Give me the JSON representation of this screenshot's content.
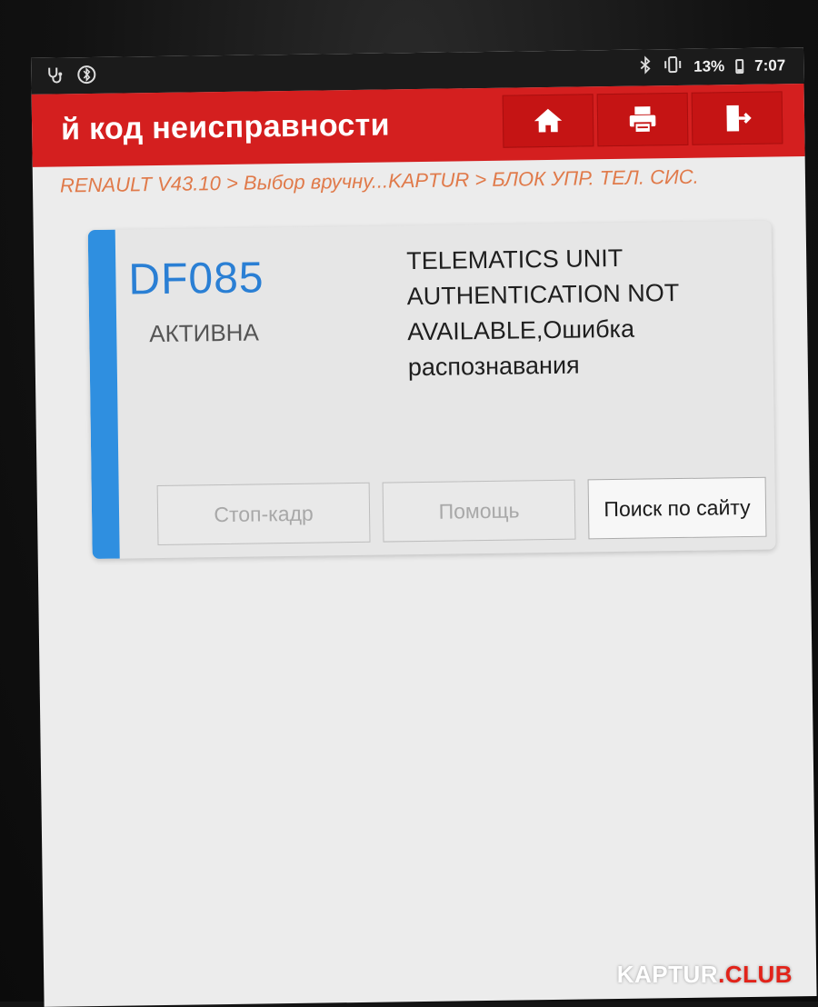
{
  "status_bar": {
    "battery_percent": "13%",
    "time": "7:07",
    "icons": [
      "stethoscope-icon",
      "bluetooth-badge-icon",
      "bluetooth-icon",
      "vibrate-icon",
      "battery-icon"
    ]
  },
  "header": {
    "title": "й код неисправности",
    "buttons": [
      {
        "name": "home",
        "icon": "home-icon"
      },
      {
        "name": "print",
        "icon": "printer-icon"
      },
      {
        "name": "exit",
        "icon": "exit-icon"
      }
    ],
    "color": "#d41f1f"
  },
  "breadcrumb": {
    "text": "RENAULT V43.10 > Выбор вручну...KAPTUR > БЛОК УПР. ТЕЛ. СИС."
  },
  "dtc": {
    "code": "DF085",
    "status": "АКТИВНА",
    "description_lines": [
      "TELEMATICS UNIT",
      "AUTHENTICATION NOT",
      "AVAILABLE,Ошибка",
      "распознавания"
    ],
    "accent_color": "#2f8fe0"
  },
  "actions": {
    "freeze_frame": "Стоп-кадр",
    "help": "Помощь",
    "web_search": "Поиск по сайту"
  },
  "watermark": {
    "part1": "KAPTUR",
    "part2": ".CLUB"
  }
}
